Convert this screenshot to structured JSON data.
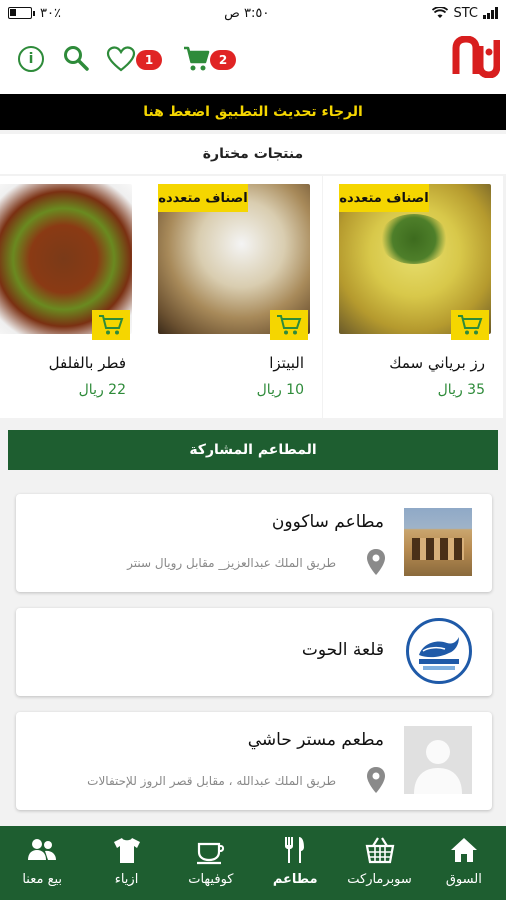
{
  "status_bar": {
    "battery_percent": "٣٠٪",
    "time": "٣:٥٠ ص",
    "carrier": "STC"
  },
  "header": {
    "favorites_count": "1",
    "cart_count": "2",
    "icons": [
      "info-icon",
      "search-icon",
      "heart-icon",
      "cart-icon",
      "logo"
    ]
  },
  "update_banner": "الرجاء تحديث التطبيق اضغط هنا",
  "featured": {
    "title": "منتجات مختارة",
    "products": [
      {
        "name": "رز برياني سمك",
        "price": "35 ريال",
        "tag": "اصناف متعدده"
      },
      {
        "name": "البيتزا",
        "price": "10 ريال",
        "tag": "اصناف متعدده"
      },
      {
        "name": "فطر بالفلفل",
        "price": "22 ريال",
        "tag": ""
      }
    ]
  },
  "restaurants": {
    "title": "المطاعم المشاركة",
    "items": [
      {
        "name": "مطاعم ساكوون",
        "address": "طريق الملك عبدالعزيز_ مقابل رويال سنتر"
      },
      {
        "name": "قلعة الحوت",
        "address": ""
      },
      {
        "name": "مطعم مستر حاشي",
        "address": "طريق الملك عبدالله ، مقابل قصر الروز للإحتفالات"
      }
    ]
  },
  "bottom_nav": {
    "items": [
      {
        "label": "السوق",
        "icon": "home-icon"
      },
      {
        "label": "سوبرماركت",
        "icon": "basket-icon"
      },
      {
        "label": "مطاعم",
        "icon": "cutlery-icon",
        "active": true
      },
      {
        "label": "كوفيهات",
        "icon": "coffee-cup-icon"
      },
      {
        "label": "ازياء",
        "icon": "shirt-icon"
      },
      {
        "label": "بيع معنا",
        "icon": "people-icon"
      }
    ]
  },
  "colors": {
    "primary_green": "#1e5e30",
    "accent_green": "#2e8b3a",
    "yellow": "#f5d600",
    "badge_red": "#e02424",
    "logo_red": "#d81e1e"
  }
}
